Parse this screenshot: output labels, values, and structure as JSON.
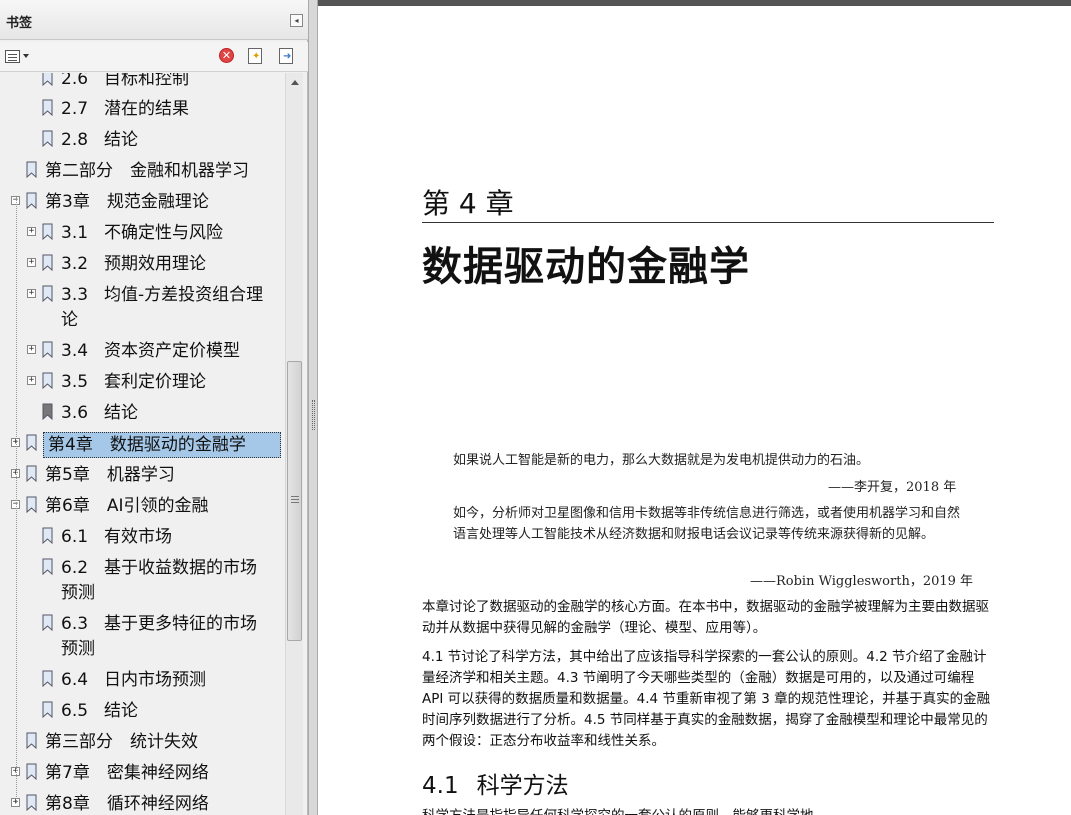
{
  "panel": {
    "title": "书签",
    "collapse_glyph": "◂",
    "toolbar": {
      "options_icon": "bookmark-options-icon",
      "delete_icon": "delete-bookmark-icon",
      "delete_glyph": "✕",
      "new_bookmark_icon": "new-bookmark-icon",
      "expand_icon": "expand-bookmark-icon"
    }
  },
  "bookmarks": [
    {
      "num": "2.6",
      "title": "目标和控制"
    },
    {
      "num": "2.7",
      "title": "潜在的结果"
    },
    {
      "num": "2.8",
      "title": "结论"
    },
    {
      "num": "",
      "title": "第二部分　金融和机器学习"
    },
    {
      "num": "",
      "title": "第3章　规范金融理论",
      "expander": "−"
    },
    {
      "num": "3.1",
      "title": "不确定性与风险",
      "expander": "+"
    },
    {
      "num": "3.2",
      "title": "预期效用理论",
      "expander": "+"
    },
    {
      "num": "3.3",
      "title": "均值-方差投资组合理",
      "title_cont": "论",
      "expander": "+"
    },
    {
      "num": "3.4",
      "title": "资本资产定价模型",
      "expander": "+"
    },
    {
      "num": "3.5",
      "title": "套利定价理论",
      "expander": "+"
    },
    {
      "num": "3.6",
      "title": "结论"
    },
    {
      "num": "",
      "title": "第4章　数据驱动的金融学",
      "expander": "+",
      "selected": true
    },
    {
      "num": "",
      "title": "第5章　机器学习",
      "expander": "+"
    },
    {
      "num": "",
      "title": "第6章　AI引领的金融",
      "expander": "−"
    },
    {
      "num": "6.1",
      "title": "有效市场"
    },
    {
      "num": "6.2",
      "title": "基于收益数据的市场",
      "title_cont": "预测"
    },
    {
      "num": "6.3",
      "title": "基于更多特征的市场",
      "title_cont": "预测"
    },
    {
      "num": "6.4",
      "title": "日内市场预测"
    },
    {
      "num": "6.5",
      "title": "结论"
    },
    {
      "num": "",
      "title": "第三部分　统计失效"
    },
    {
      "num": "",
      "title": "第7章　密集神经网络",
      "expander": "+"
    },
    {
      "num": "",
      "title": "第8章　循环神经网络",
      "expander": "+"
    }
  ],
  "document": {
    "chapter_number": "第 4 章",
    "chapter_title": "数据驱动的金融学",
    "quote1": "如果说人工智能是新的电力，那么大数据就是为发电机提供动力的石油。",
    "quote1_attrib": "——李开复，2018 年",
    "quote2": "如今，分析师对卫星图像和信用卡数据等非传统信息进行筛选，或者使用机器学习和自然语言处理等人工智能技术从经济数据和财报电话会议记录等传统来源获得新的见解。",
    "quote2_attrib": "——Robin Wigglesworth，2019 年",
    "para1": "本章讨论了数据驱动的金融学的核心方面。在本书中，数据驱动的金融学被理解为主要由数据驱动并从数据中获得见解的金融学（理论、模型、应用等）。",
    "para2": "4.1 节讨论了科学方法，其中给出了应该指导科学探索的一套公认的原则。4.2 节介绍了金融计量经济学和相关主题。4.3 节阐明了今天哪些类型的（金融）数据是可用的，以及通过可编程 API 可以获得的数据质量和数据量。4.4 节重新审视了第 3 章的规范性理论，并基于真实的金融时间序列数据进行了分析。4.5 节同样基于真实的金融数据，揭穿了金融模型和理论中最常见的两个假设：正态分布收益率和线性关系。",
    "section_num": "4.1",
    "section_title": "科学方法",
    "cut_line": "科学方法是指指导任何科学探究的一套公认的原则，能够更科学地"
  }
}
